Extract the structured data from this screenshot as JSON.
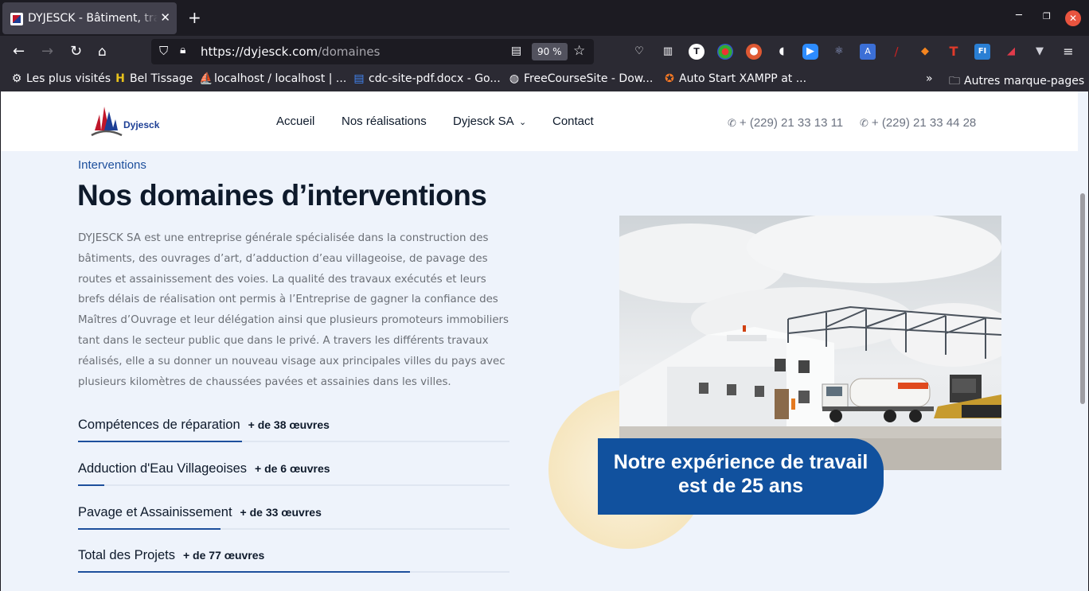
{
  "browser": {
    "tab_title": "DYJESCK - Bâtiment, travaux publics",
    "new_tab_label": "+",
    "url_host": "https://dyjesck.com",
    "url_path": "/domaines",
    "zoom": "90 %",
    "bookmarks": [
      {
        "label": "Les plus visités",
        "icon": "gear-icon"
      },
      {
        "label": "Bel Tissage",
        "icon": "bt-favicon"
      },
      {
        "label": "localhost / localhost | ...",
        "icon": "phpmyadmin-favicon"
      },
      {
        "label": "cdc-site-pdf.docx - Go...",
        "icon": "google-docs-favicon"
      },
      {
        "label": "FreeCourseSite - Dow...",
        "icon": "globe-icon"
      },
      {
        "label": "Auto Start XAMPP at ...",
        "icon": "xampp-favicon"
      }
    ],
    "other_bookmarks": "Autres marque-pages"
  },
  "site": {
    "logo_text": "Dyjesck",
    "menu": [
      "Accueil",
      "Nos réalisations",
      "Dyjesck SA",
      "Contact"
    ],
    "menu_dropdown_icon": "chevron-down-icon",
    "phones": [
      "+ (229) 21 33 13 11",
      "+ (229) 21 33 44 28"
    ]
  },
  "content": {
    "eyebrow": "Interventions",
    "heading": "Nos domaines d’interventions",
    "paragraph": "DYJESCK SA est une entreprise générale spécialisée dans la construction des bâtiments, des ouvrages d’art, d’adduction d’eau villageoise, de pavage des routes et assainissement des voies. La qualité des travaux exécutés et leurs brefs délais de réalisation ont permis à l’Entreprise de gagner la confiance des Maîtres d’Ouvrage et leur délégation ainsi que plusieurs promoteurs immobiliers tant dans le secteur public que dans le privé. A travers les différents travaux réalisés, elle a su donner un nouveau visage aux principales villes du pays avec plusieurs kilomètres de chaussées pavées et assainies dans les villes.",
    "skills": [
      {
        "name": "Compétences de réparation",
        "count": "+ de 38 œuvres",
        "fraction": 0.38
      },
      {
        "name": "Adduction d'Eau Villageoises",
        "count": "+ de 6 œuvres",
        "fraction": 0.06
      },
      {
        "name": "Pavage et Assainissement",
        "count": "+ de 33 œuvres",
        "fraction": 0.33
      },
      {
        "name": "Total des Projets",
        "count": "+ de 77 œuvres",
        "fraction": 0.77
      }
    ],
    "badge": "Notre expérience de travail est de 25 ans"
  },
  "colors": {
    "brand_blue": "#11519e",
    "accent_gold": "#f6e6bf",
    "page_bg": "#eef3fb"
  }
}
